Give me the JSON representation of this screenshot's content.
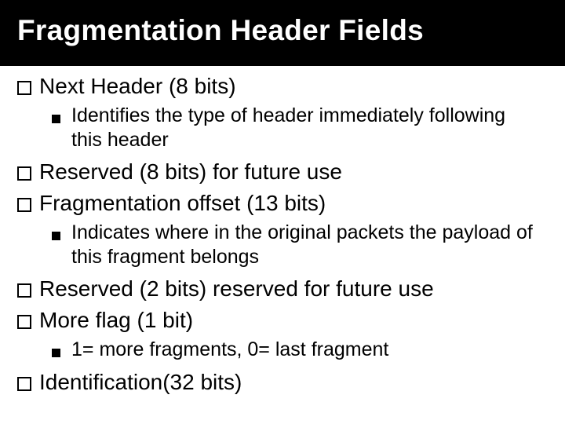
{
  "title": "Fragmentation Header Fields",
  "items": [
    {
      "label": "Next Header (8 bits)",
      "sub": [
        "Identifies the type of header immediately following this header"
      ]
    },
    {
      "label": "Reserved (8 bits) for future use",
      "sub": []
    },
    {
      "label": "Fragmentation offset (13 bits)",
      "sub": [
        "Indicates where in the original packets the payload of this fragment belongs"
      ]
    },
    {
      "label": "Reserved (2 bits) reserved for future use",
      "sub": []
    },
    {
      "label": "More flag (1 bit)",
      "sub": [
        "1= more fragments, 0= last fragment"
      ]
    },
    {
      "label": "Identification(32 bits)",
      "sub": []
    }
  ]
}
